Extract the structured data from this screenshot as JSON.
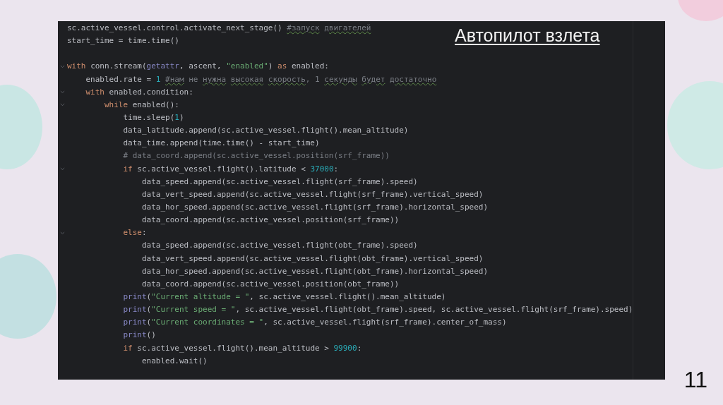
{
  "slide": {
    "title": "Автопилот взлета",
    "page_number": "11"
  },
  "code_lines": [
    {
      "kind": "code",
      "fold": false,
      "tokens": [
        {
          "kind": "plain",
          "text": "sc.active_vessel.control.activate_next_stage() "
        },
        {
          "kind": "typo",
          "text": "#запуск"
        },
        {
          "kind": "typo",
          "text": " двигателей"
        }
      ]
    },
    {
      "kind": "code",
      "fold": false,
      "tokens": [
        {
          "kind": "plain",
          "text": "start_time = time.time()"
        }
      ]
    },
    {
      "kind": "blank"
    },
    {
      "kind": "code",
      "fold": true,
      "tokens": [
        {
          "kind": "keyword",
          "text": "with "
        },
        {
          "kind": "plain",
          "text": "conn.stream("
        },
        {
          "kind": "builtin",
          "text": "getattr"
        },
        {
          "kind": "plain",
          "text": ", ascent, "
        },
        {
          "kind": "string",
          "text": "\"enabled\""
        },
        {
          "kind": "plain",
          "text": ") "
        },
        {
          "kind": "keyword",
          "text": "as "
        },
        {
          "kind": "plain",
          "text": "enabled:"
        }
      ]
    },
    {
      "kind": "code",
      "fold": false,
      "tokens": [
        {
          "kind": "plain",
          "text": "    enabled.rate = "
        },
        {
          "kind": "number",
          "text": "1 "
        },
        {
          "kind": "typo",
          "text": "#нам"
        },
        {
          "kind": "comment",
          "text": " не "
        },
        {
          "kind": "typo",
          "text": "нужна"
        },
        {
          "kind": "typo",
          "text": " высокая"
        },
        {
          "kind": "typo",
          "text": " скорость"
        },
        {
          "kind": "comment",
          "text": ", 1 "
        },
        {
          "kind": "typo",
          "text": "секунды"
        },
        {
          "kind": "typo",
          "text": " будет"
        },
        {
          "kind": "typo",
          "text": " достаточно"
        }
      ]
    },
    {
      "kind": "code",
      "fold": true,
      "tokens": [
        {
          "kind": "keyword",
          "text": "    with "
        },
        {
          "kind": "plain",
          "text": "enabled.condition:"
        }
      ]
    },
    {
      "kind": "code",
      "fold": true,
      "tokens": [
        {
          "kind": "keyword",
          "text": "        while "
        },
        {
          "kind": "plain",
          "text": "enabled():"
        }
      ]
    },
    {
      "kind": "code",
      "fold": false,
      "tokens": [
        {
          "kind": "plain",
          "text": "            time.sleep("
        },
        {
          "kind": "number",
          "text": "1"
        },
        {
          "kind": "plain",
          "text": ")"
        }
      ]
    },
    {
      "kind": "code",
      "fold": false,
      "tokens": [
        {
          "kind": "plain",
          "text": "            data_latitude.append(sc.active_vessel.flight().mean_altitude)"
        }
      ]
    },
    {
      "kind": "code",
      "fold": false,
      "tokens": [
        {
          "kind": "plain",
          "text": "            data_time.append(time.time() - start_time)"
        }
      ]
    },
    {
      "kind": "code",
      "fold": false,
      "tokens": [
        {
          "kind": "comment",
          "text": "            # data_coord.append(sc.active_vessel.position(srf_frame))"
        }
      ]
    },
    {
      "kind": "code",
      "fold": true,
      "tokens": [
        {
          "kind": "keyword",
          "text": "            if "
        },
        {
          "kind": "plain",
          "text": "sc.active_vessel.flight().latitude < "
        },
        {
          "kind": "number",
          "text": "37000"
        },
        {
          "kind": "plain",
          "text": ":"
        }
      ]
    },
    {
      "kind": "code",
      "fold": false,
      "tokens": [
        {
          "kind": "plain",
          "text": "                data_speed.append(sc.active_vessel.flight(srf_frame).speed)"
        }
      ]
    },
    {
      "kind": "code",
      "fold": false,
      "tokens": [
        {
          "kind": "plain",
          "text": "                data_vert_speed.append(sc.active_vessel.flight(srf_frame).vertical_speed)"
        }
      ]
    },
    {
      "kind": "code",
      "fold": false,
      "tokens": [
        {
          "kind": "plain",
          "text": "                data_hor_speed.append(sc.active_vessel.flight(srf_frame).horizontal_speed)"
        }
      ]
    },
    {
      "kind": "code",
      "fold": false,
      "tokens": [
        {
          "kind": "plain",
          "text": "                data_coord.append(sc.active_vessel.position(srf_frame))"
        }
      ]
    },
    {
      "kind": "code",
      "fold": true,
      "tokens": [
        {
          "kind": "keyword",
          "text": "            else"
        },
        {
          "kind": "plain",
          "text": ":"
        }
      ]
    },
    {
      "kind": "code",
      "fold": false,
      "tokens": [
        {
          "kind": "plain",
          "text": "                data_speed.append(sc.active_vessel.flight(obt_frame).speed)"
        }
      ]
    },
    {
      "kind": "code",
      "fold": false,
      "tokens": [
        {
          "kind": "plain",
          "text": "                data_vert_speed.append(sc.active_vessel.flight(obt_frame).vertical_speed)"
        }
      ]
    },
    {
      "kind": "code",
      "fold": false,
      "tokens": [
        {
          "kind": "plain",
          "text": "                data_hor_speed.append(sc.active_vessel.flight(obt_frame).horizontal_speed)"
        }
      ]
    },
    {
      "kind": "code",
      "fold": false,
      "tokens": [
        {
          "kind": "plain",
          "text": "                data_coord.append(sc.active_vessel.position(obt_frame))"
        }
      ]
    },
    {
      "kind": "code",
      "fold": false,
      "tokens": [
        {
          "kind": "builtin",
          "text": "            print"
        },
        {
          "kind": "plain",
          "text": "("
        },
        {
          "kind": "string",
          "text": "\"Current altitude = \""
        },
        {
          "kind": "plain",
          "text": ", sc.active_vessel.flight().mean_altitude)"
        }
      ]
    },
    {
      "kind": "code",
      "fold": false,
      "tokens": [
        {
          "kind": "builtin",
          "text": "            print"
        },
        {
          "kind": "plain",
          "text": "("
        },
        {
          "kind": "string",
          "text": "\"Current speed = \""
        },
        {
          "kind": "plain",
          "text": ", sc.active_vessel.flight(obt_frame).speed, sc.active_vessel.flight(srf_frame).speed)"
        }
      ]
    },
    {
      "kind": "code",
      "fold": false,
      "tokens": [
        {
          "kind": "builtin",
          "text": "            print"
        },
        {
          "kind": "plain",
          "text": "("
        },
        {
          "kind": "string",
          "text": "\"Current coordinates = \""
        },
        {
          "kind": "plain",
          "text": ", sc.active_vessel.flight(srf_frame).center_of_mass)"
        }
      ]
    },
    {
      "kind": "code",
      "fold": false,
      "tokens": [
        {
          "kind": "builtin",
          "text": "            print"
        },
        {
          "kind": "plain",
          "text": "()"
        }
      ]
    },
    {
      "kind": "code",
      "fold": false,
      "tokens": [
        {
          "kind": "keyword",
          "text": "            if "
        },
        {
          "kind": "plain",
          "text": "sc.active_vessel.flight().mean_altitude > "
        },
        {
          "kind": "number",
          "text": "99900"
        },
        {
          "kind": "plain",
          "text": ":"
        }
      ]
    },
    {
      "kind": "code",
      "fold": false,
      "tokens": [
        {
          "kind": "plain",
          "text": "                enabled.wait()"
        }
      ]
    }
  ]
}
